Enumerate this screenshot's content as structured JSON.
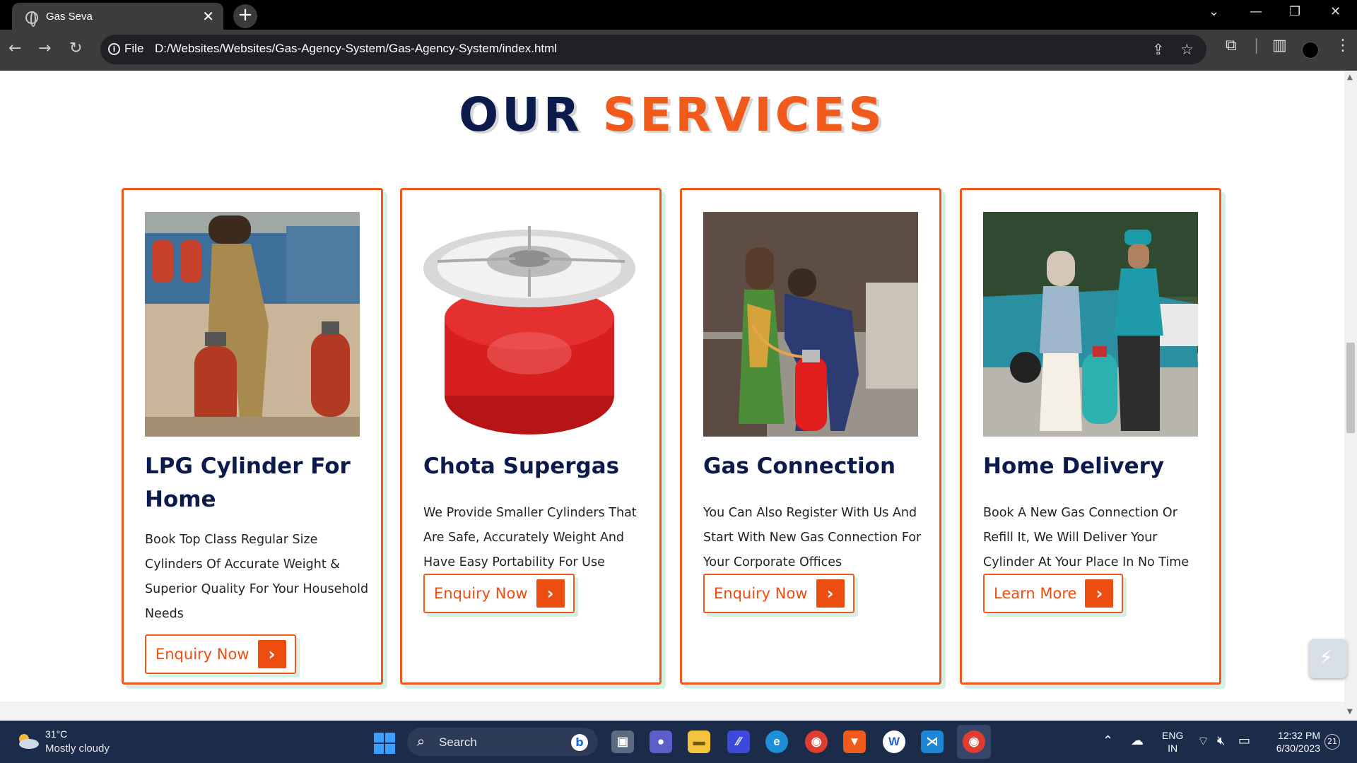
{
  "browser": {
    "tab_title": "Gas Seva",
    "tab_close": "✕",
    "new_tab": "+",
    "omnibox_scheme": "File",
    "omnibox_url": "D:/Websites/Websites/Gas-Agency-System/Gas-Agency-System/index.html",
    "icons": [
      "back-icon",
      "forward-icon",
      "reload-icon",
      "info-icon",
      "share-icon",
      "star-icon",
      "extensions-icon",
      "sidebar-icon",
      "profile-avatar",
      "menu-icon"
    ]
  },
  "page": {
    "heading_word1": "OUR",
    "heading_word2": "SERVICES",
    "accent_color": "#ee5a1c",
    "navy_color": "#0d1b4c",
    "cards": [
      {
        "title": "LPG Cylinder For Home",
        "description": "Book Top Class Regular Size Cylinders Of Accurate Weight & Superior Quality For Your Household Needs",
        "button_label": "Enquiry Now",
        "image": "man-lifting-red-lpg-cylinders-photo"
      },
      {
        "title": "Chota Supergas",
        "description": "We Provide Smaller Cylinders That Are Safe, Accurately Weight And Have Easy Portability For Use",
        "button_label": "Enquiry Now",
        "image": "red-mini-gas-stove-cylinder-photo"
      },
      {
        "title": "Gas Connection",
        "description": "You Can Also Register With Us And Start With New Gas Connection For Your Corporate Offices",
        "button_label": "Enquiry Now",
        "image": "technician-connecting-cylinder-in-kitchen-photo"
      },
      {
        "title": "Home Delivery",
        "description": "Book A New Gas Connection Or Refill It, We Will Deliver Your Cylinder At Your Place In No Time",
        "button_label": "Learn More",
        "image": "delivery-man-with-teal-cylinder-photo"
      }
    ]
  },
  "taskbar": {
    "temperature": "31°C",
    "weather": "Mostly cloudy",
    "search_label": "Search",
    "language_line1": "ENG",
    "language_line2": "IN",
    "time": "12:32 PM",
    "date": "6/30/2023",
    "notification_count": "21"
  }
}
